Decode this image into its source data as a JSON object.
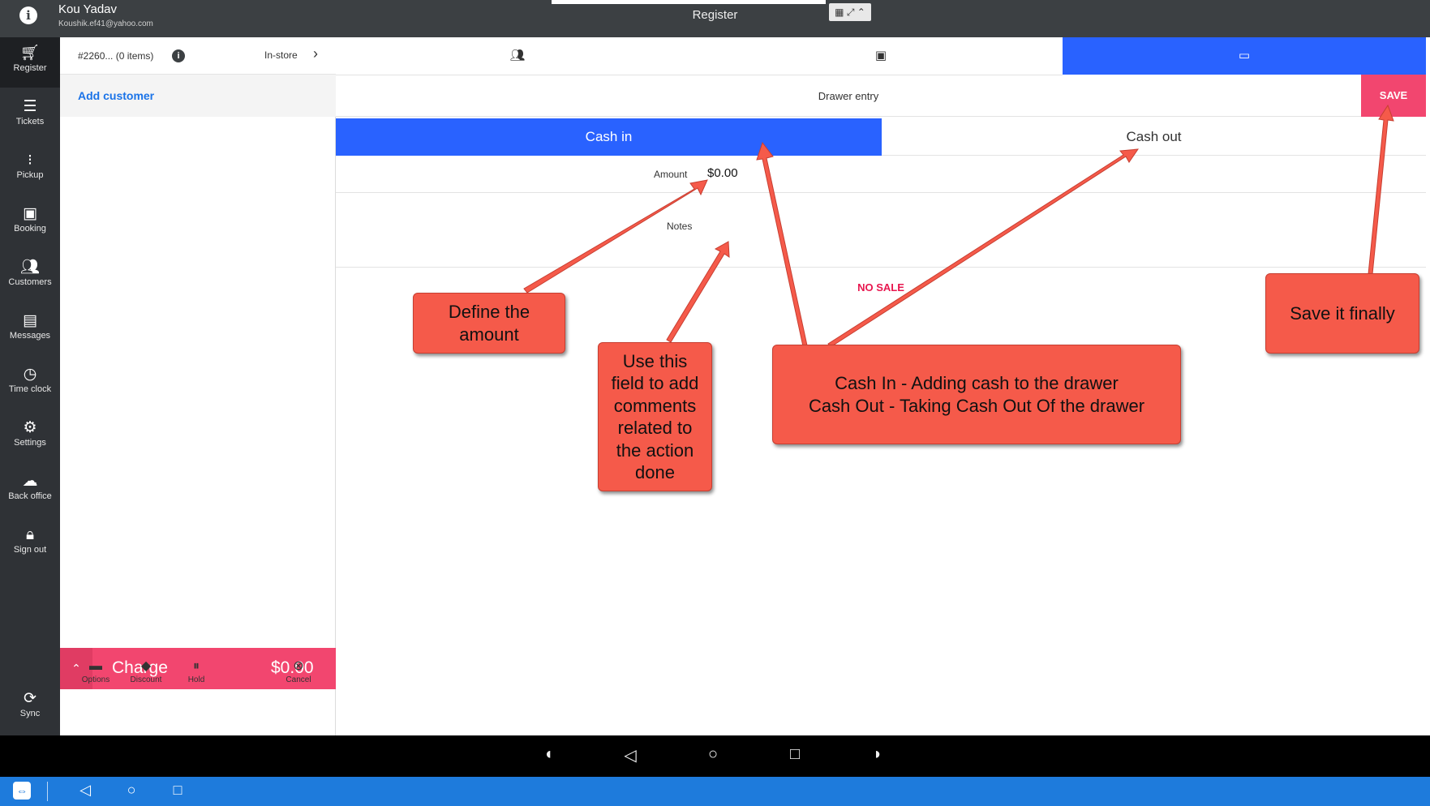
{
  "topbar": {
    "user_name": "Kou Yadav",
    "user_email": "Koushik.ef41@yahoo.com",
    "title": "Register"
  },
  "sidebar": {
    "items": [
      {
        "label": "Register",
        "icon": "cart-icon"
      },
      {
        "label": "Tickets",
        "icon": "receipt-icon"
      },
      {
        "label": "Pickup",
        "icon": "traffic-icon"
      },
      {
        "label": "Booking",
        "icon": "calendar-icon"
      },
      {
        "label": "Customers",
        "icon": "people-icon"
      },
      {
        "label": "Messages",
        "icon": "message-icon"
      },
      {
        "label": "Time clock",
        "icon": "clock-icon"
      },
      {
        "label": "Settings",
        "icon": "gear-icon"
      },
      {
        "label": "Back office",
        "icon": "cloud-icon"
      },
      {
        "label": "Sign out",
        "icon": "lock-icon"
      }
    ],
    "sync_label": "Sync"
  },
  "order": {
    "id_label": "#2260... (0 items)",
    "type": "In-store",
    "add_customer": "Add customer",
    "charge_label": "Charge",
    "charge_amount": "$0.00",
    "actions": [
      {
        "label": "Options",
        "icon": "dots-icon"
      },
      {
        "label": "Discount",
        "icon": "tag-icon"
      },
      {
        "label": "Hold",
        "icon": "pause-icon"
      },
      {
        "label": "Cancel",
        "icon": "cancel-icon"
      }
    ]
  },
  "main": {
    "drawer_title": "Drawer entry",
    "save_label": "SAVE",
    "cash_in": "Cash in",
    "cash_out": "Cash out",
    "amount_label": "Amount",
    "amount_value": "$0.00",
    "notes_label": "Notes",
    "no_sale": "NO SALE"
  },
  "annotations": {
    "amount": "Define the\namount",
    "notes": "Use this\nfield to add\ncomments\nrelated to\nthe action\ndone",
    "cash": "Cash In - Adding cash to the drawer\nCash Out - Taking Cash Out Of the drawer",
    "save": "Save it finally"
  },
  "colors": {
    "accent_blue": "#2962ff",
    "accent_pink": "#f2466f",
    "callout": "#f55a4a",
    "sidebar": "#2f3236"
  }
}
